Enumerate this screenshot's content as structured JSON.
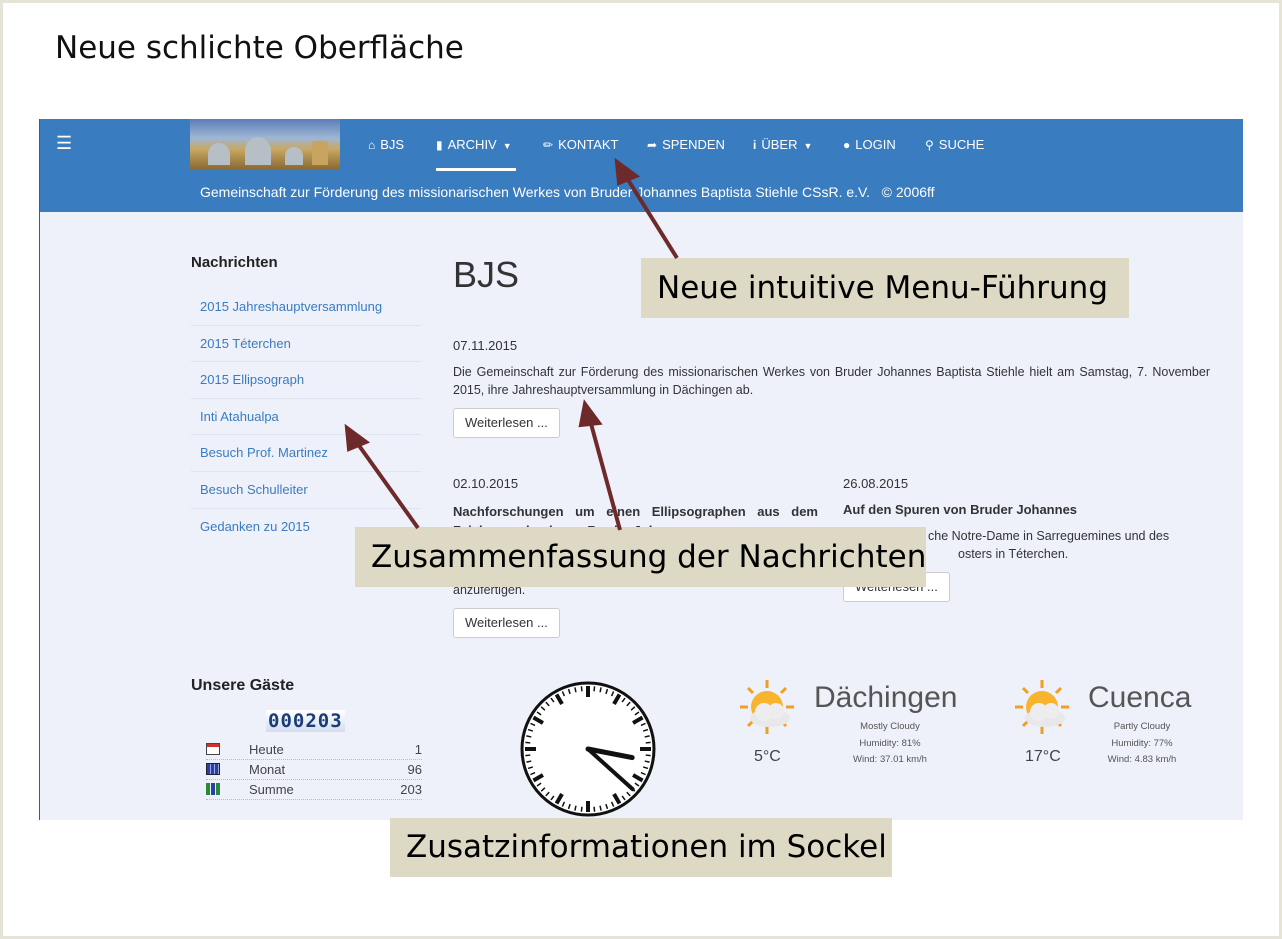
{
  "slide": {
    "title": "Neue schlichte Oberfläche"
  },
  "navbar": {
    "menu_icon": "hamburger-icon",
    "items": [
      {
        "label": "BJS",
        "icon": "home-icon"
      },
      {
        "label": "ARCHIV",
        "icon": "book-icon",
        "dropdown": true
      },
      {
        "label": "KONTAKT",
        "icon": "paperclip-icon"
      },
      {
        "label": "SPENDEN",
        "icon": "share-icon"
      },
      {
        "label": "ÜBER",
        "icon": "info-icon",
        "dropdown": true
      },
      {
        "label": "LOGIN",
        "icon": "user-icon"
      },
      {
        "label": "SUCHE",
        "icon": "search-icon"
      }
    ],
    "active": "ARCHIV",
    "color": "#3a7cc0"
  },
  "subbar": {
    "text": "Gemeinschaft zur Förderung des missionarischen Werkes von Bruder Johannes Baptista Stiehle CSsR. e.V.   © 2006ff"
  },
  "sidebar": {
    "heading": "Nachrichten",
    "items": [
      "2015 Jahreshauptversammlung",
      "2015 Téterchen",
      "2015 Ellipsograph",
      "Inti Atahualpa",
      "Besuch Prof. Martinez",
      "Besuch Schulleiter",
      "Gedanken zu 2015"
    ]
  },
  "main": {
    "title": "BJS",
    "articles": [
      {
        "date": "07.11.2015",
        "text": "Die Gemeinschaft zur Förderung des missionarischen Werkes von Bruder Johannes Baptista Stiehle hielt am Samstag, 7. November 2015, ihre Jahreshauptversammlung in Dächingen ab.",
        "button": "Weiterlesen ..."
      },
      {
        "date": "02.10.2015",
        "title": "Nachforschungen um einen Ellipsographen aus dem Zeichnungsbuch von Bruder Johannes",
        "text_end": "anzufertigen.",
        "button": "Weiterlesen ..."
      },
      {
        "date": "26.08.2015",
        "title": "Auf den Spuren von Bruder Johannes",
        "text_line1": "che Notre-Dame in Sarreguemines und des",
        "text_line2": "osters in Téterchen.",
        "button": "Weiterlesen ..."
      }
    ]
  },
  "footer": {
    "guests_heading": "Unsere Gäste",
    "counter": "000203",
    "stats": [
      {
        "label": "Heute",
        "value": "1",
        "icon": "calendar-day-icon"
      },
      {
        "label": "Monat",
        "value": "96",
        "icon": "calendar-month-icon"
      },
      {
        "label": "Summe",
        "value": "203",
        "icon": "bar-chart-icon"
      }
    ],
    "clock": {
      "hour": 3,
      "minute": 22
    },
    "weather": [
      {
        "city": "Dächingen",
        "temp": "5°C",
        "condition": "Mostly Cloudy",
        "humidity": "Humidity: 81%",
        "wind": "Wind: 37.01 km/h",
        "icon": "sun-cloud-icon"
      },
      {
        "city": "Cuenca",
        "temp": "17°C",
        "condition": "Partly Cloudy",
        "humidity": "Humidity: 77%",
        "wind": "Wind: 4.83 km/h",
        "icon": "sun-cloud-icon"
      }
    ]
  },
  "callouts": {
    "menu": "Neue intuitive Menu-Führung",
    "news": "Zusammenfassung der Nachrichten",
    "footer": "Zusatzinformationen im Sockel"
  },
  "arrow_color": "#6e2a2a",
  "callout_color": "#ddd9c4"
}
